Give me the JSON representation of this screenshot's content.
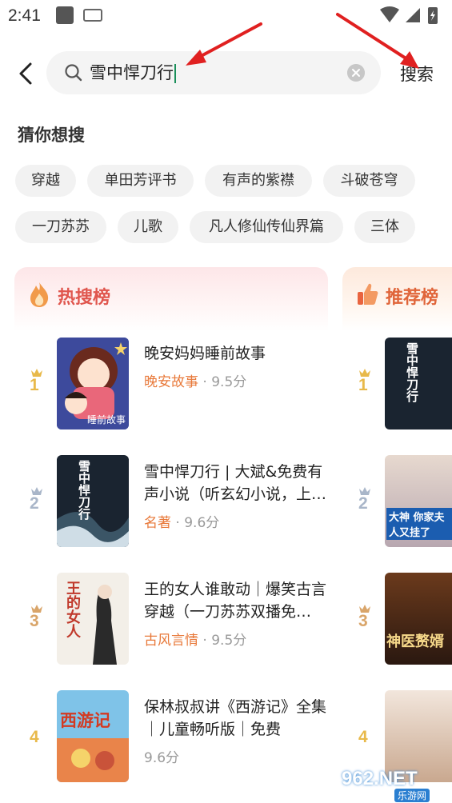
{
  "status_bar": {
    "time": "2:41"
  },
  "search": {
    "query": "雪中悍刀行",
    "button_label": "搜索"
  },
  "suggestions": {
    "title": "猜你想搜",
    "tags": [
      "穿越",
      "单田芳评书",
      "有声的紫襟",
      "斗破苍穹",
      "一刀苏苏",
      "儿歌",
      "凡人修仙传仙界篇",
      "三体"
    ]
  },
  "boards": {
    "hot": {
      "title": "热搜榜"
    },
    "recommend": {
      "title": "推荐榜"
    }
  },
  "hot_list": [
    {
      "rank": "1",
      "title": "晚安妈妈睡前故事",
      "category": "晚安故事",
      "score": "9.5分",
      "cover_text": "睡前故事"
    },
    {
      "rank": "2",
      "title": "雪中悍刀行 | 大斌&免费有声小说（听玄幻小说，上…",
      "category": "名著",
      "score": "9.6分",
      "cover_text": "雪中悍刀行"
    },
    {
      "rank": "3",
      "title": "王的女人谁敢动｜爆笑古言穿越（一刀苏苏双播免…",
      "category": "古风言情",
      "score": "9.5分",
      "cover_text": "王的女人"
    },
    {
      "rank": "4",
      "title": "保林叔叔讲《西游记》全集｜儿童畅听版｜免费",
      "category": "",
      "score": "9.6分",
      "cover_text": "西游记"
    }
  ],
  "rec_list": [
    {
      "rank": "1",
      "cover_text": "雪中悍刀行"
    },
    {
      "rank": "2",
      "cover_text": "大神 你家夫人又挂了"
    },
    {
      "rank": "3",
      "cover_text": "神医赘婿"
    },
    {
      "rank": "4",
      "cover_text": ""
    }
  ],
  "watermark": {
    "text": "962.NET",
    "sub": "乐游网"
  },
  "colors": {
    "accent": "#e8793a",
    "hot_title": "#e0564e",
    "rec_title": "#e0653a",
    "crown_gold": "#e8b94a",
    "crown_silver": "#a9b6c9",
    "crown_bronze": "#d9a56a"
  }
}
